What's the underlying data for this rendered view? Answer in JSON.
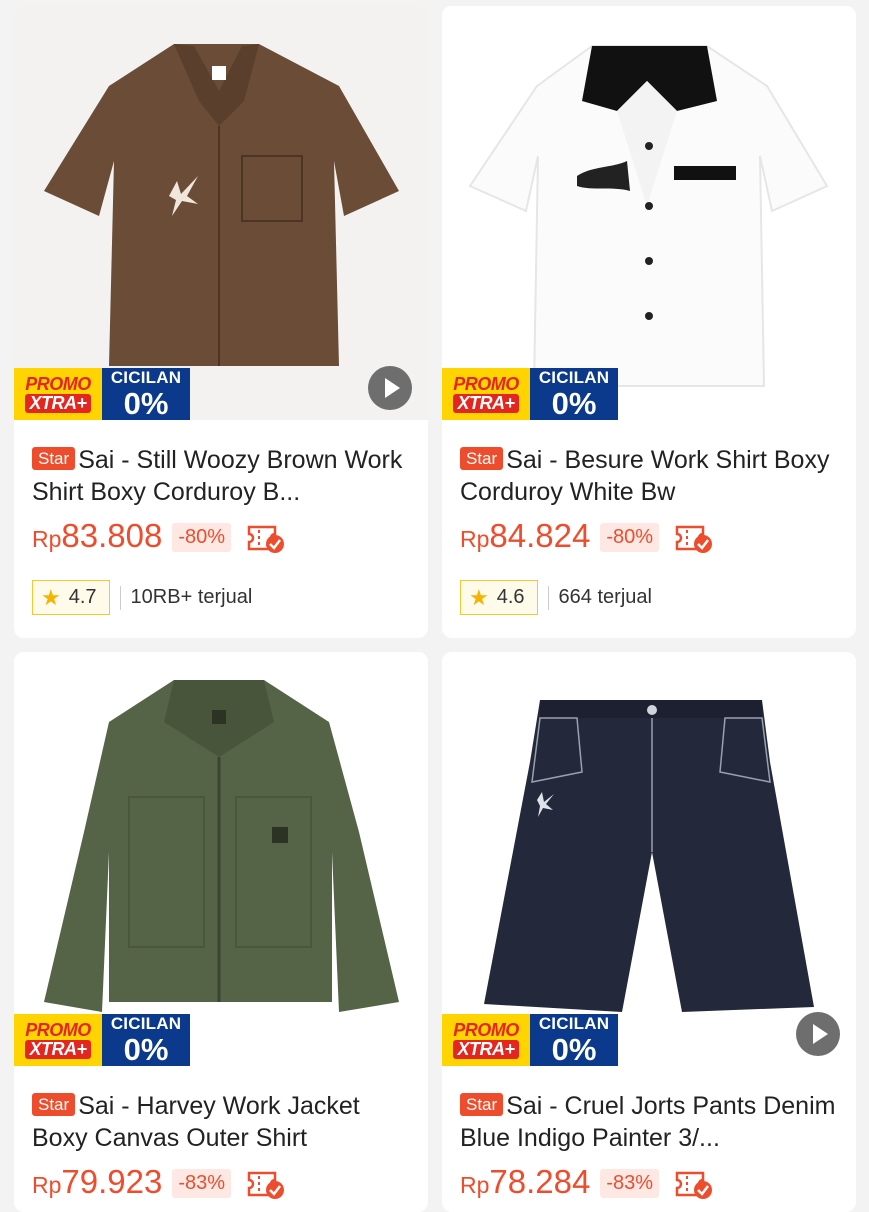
{
  "products": [
    {
      "tag": "Star",
      "title": "Sai - Still Woozy Brown Work Shirt Boxy Corduroy B...",
      "currency": "Rp",
      "price": "83.808",
      "discount": "-80%",
      "rating": "4.7",
      "sold": "10RB+ terjual",
      "promo_line1": "PROMO",
      "promo_line2": "XTRA+",
      "cicilan_line1": "CICILAN",
      "cicilan_line2": "0%"
    },
    {
      "tag": "Star",
      "title": "Sai - Besure Work Shirt Boxy Corduroy White Bw",
      "currency": "Rp",
      "price": "84.824",
      "discount": "-80%",
      "rating": "4.6",
      "sold": "664 terjual",
      "promo_line1": "PROMO",
      "promo_line2": "XTRA+",
      "cicilan_line1": "CICILAN",
      "cicilan_line2": "0%"
    },
    {
      "tag": "Star",
      "title": "Sai - Harvey Work Jacket Boxy Canvas Outer Shirt",
      "currency": "Rp",
      "price": "79.923",
      "discount": "-83%",
      "promo_line1": "PROMO",
      "promo_line2": "XTRA+",
      "cicilan_line1": "CICILAN",
      "cicilan_line2": "0%"
    },
    {
      "tag": "Star",
      "title": "Sai - Cruel Jorts Pants Denim Blue Indigo Painter 3/...",
      "currency": "Rp",
      "price": "78.284",
      "discount": "-83%",
      "promo_line1": "PROMO",
      "promo_line2": "XTRA+",
      "cicilan_line1": "CICILAN",
      "cicilan_line2": "0%"
    }
  ],
  "colors": {
    "accent": "#ee4d2d",
    "promo_yellow": "#ffd400",
    "cicilan_blue": "#0b3a8c",
    "rating_star": "#f4b400"
  },
  "icons": {
    "play": "play-icon",
    "voucher": "voucher-icon",
    "rating": "star-icon"
  }
}
